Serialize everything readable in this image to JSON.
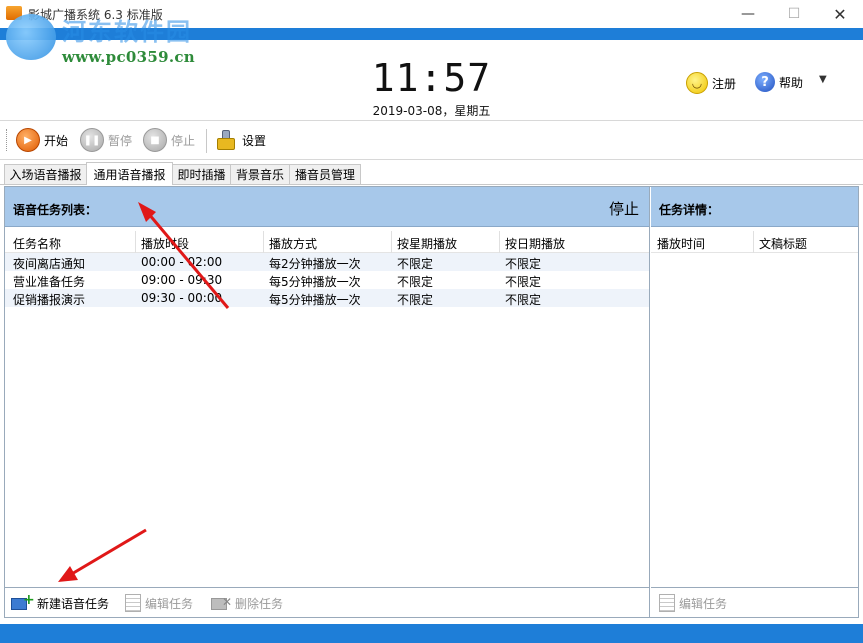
{
  "window": {
    "title": "影城广播系统 6.3 标准版",
    "minimize": "—",
    "maximize": "☐",
    "close": "✕"
  },
  "watermark": {
    "site_cn": "河东软件园",
    "url": "www.pc0359.cn"
  },
  "header": {
    "time": "11:57",
    "date": "2019-03-08，星期五",
    "register_label": "注册",
    "help_label": "帮助",
    "dropdown_caret": "▼"
  },
  "toolbar": {
    "start_label": "开始",
    "pause_label": "暂停",
    "stop_label": "停止",
    "settings_label": "设置"
  },
  "tabs": [
    {
      "label": "入场语音播报",
      "active": false
    },
    {
      "label": "通用语音播报",
      "active": true
    },
    {
      "label": "即时插播",
      "active": false
    },
    {
      "label": "背景音乐",
      "active": false
    },
    {
      "label": "播音员管理",
      "active": false
    }
  ],
  "task_list": {
    "title": "语音任务列表：",
    "status": "停止",
    "columns": [
      "任务名称",
      "播放时段",
      "播放方式",
      "按星期播放",
      "按日期播放"
    ],
    "rows": [
      [
        "夜间离店通知",
        "00:00 - 02:00",
        "每2分钟播放一次",
        "不限定",
        "不限定"
      ],
      [
        "营业准备任务",
        "09:00 - 09:30",
        "每5分钟播放一次",
        "不限定",
        "不限定"
      ],
      [
        "促销播报演示",
        "09:30 - 00:00",
        "每5分钟播放一次",
        "不限定",
        "不限定"
      ]
    ],
    "footer": {
      "new_label": "新建语音任务",
      "edit_label": "编辑任务",
      "delete_label": "删除任务"
    }
  },
  "task_detail": {
    "title": "任务详情：",
    "columns": [
      "播放时间",
      "文稿标题"
    ],
    "footer": {
      "edit_label": "编辑任务"
    }
  },
  "colors": {
    "brand_blue": "#1e7ed8",
    "panel_header": "#a7c8ea",
    "arrow_red": "#e01818"
  }
}
